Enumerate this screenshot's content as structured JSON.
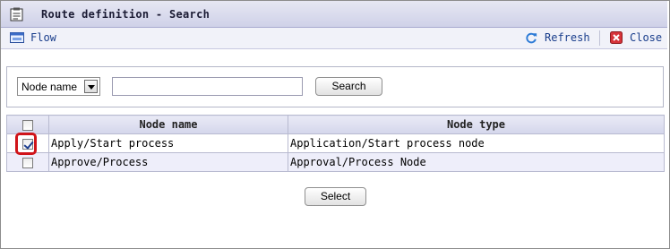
{
  "window": {
    "title": "Route definition - Search"
  },
  "toolbar": {
    "flow_label": "Flow",
    "refresh_label": "Refresh",
    "close_label": "Close"
  },
  "search": {
    "field_select_value": "Node name",
    "input_value": "",
    "search_button": "Search"
  },
  "table": {
    "columns": [
      "Node name",
      "Node type"
    ],
    "rows": [
      {
        "checked": true,
        "node_name": "Apply/Start process",
        "node_type": "Application/Start process node"
      },
      {
        "checked": false,
        "node_name": "Approve/Process",
        "node_type": "Approval/Process Node"
      }
    ]
  },
  "actions": {
    "select_button": "Select"
  },
  "colors": {
    "highlight": "#d0141a",
    "header_bg": "#d4d6eb",
    "link": "#1a3e8c"
  }
}
